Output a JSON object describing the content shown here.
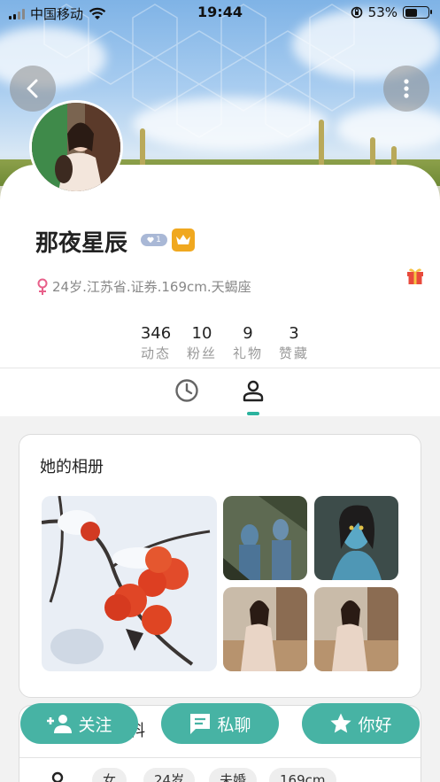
{
  "status_bar": {
    "carrier": "中国移动",
    "time": "19:44",
    "battery_percent": "53%",
    "battery_level": 0.53
  },
  "nav": {
    "back_icon": "chevron-left-icon",
    "more_icon": "more-vertical-icon"
  },
  "profile": {
    "name": "那夜星辰",
    "heart_badge_count": "1",
    "info": "24岁.江苏省.证券.169cm.天蝎座",
    "stats": [
      {
        "value": "346",
        "label": "动态"
      },
      {
        "value": "10",
        "label": "粉丝"
      },
      {
        "value": "9",
        "label": "礼物"
      },
      {
        "value": "3",
        "label": "赞藏"
      }
    ]
  },
  "tabs": [
    {
      "icon": "clock-icon",
      "active": false
    },
    {
      "icon": "person-icon",
      "active": true
    }
  ],
  "album": {
    "title": "她的相册"
  },
  "info_card": {
    "title_visible": "料",
    "chips": [
      "女",
      "24岁",
      "未婚",
      "169cm"
    ]
  },
  "actions": {
    "follow": "关注",
    "chat": "私聊",
    "hello": "你好"
  },
  "colors": {
    "accent": "#47b3a4",
    "indicator": "#2bb39e",
    "crown_badge": "#f0a81f",
    "female_icon": "#e8608a"
  }
}
